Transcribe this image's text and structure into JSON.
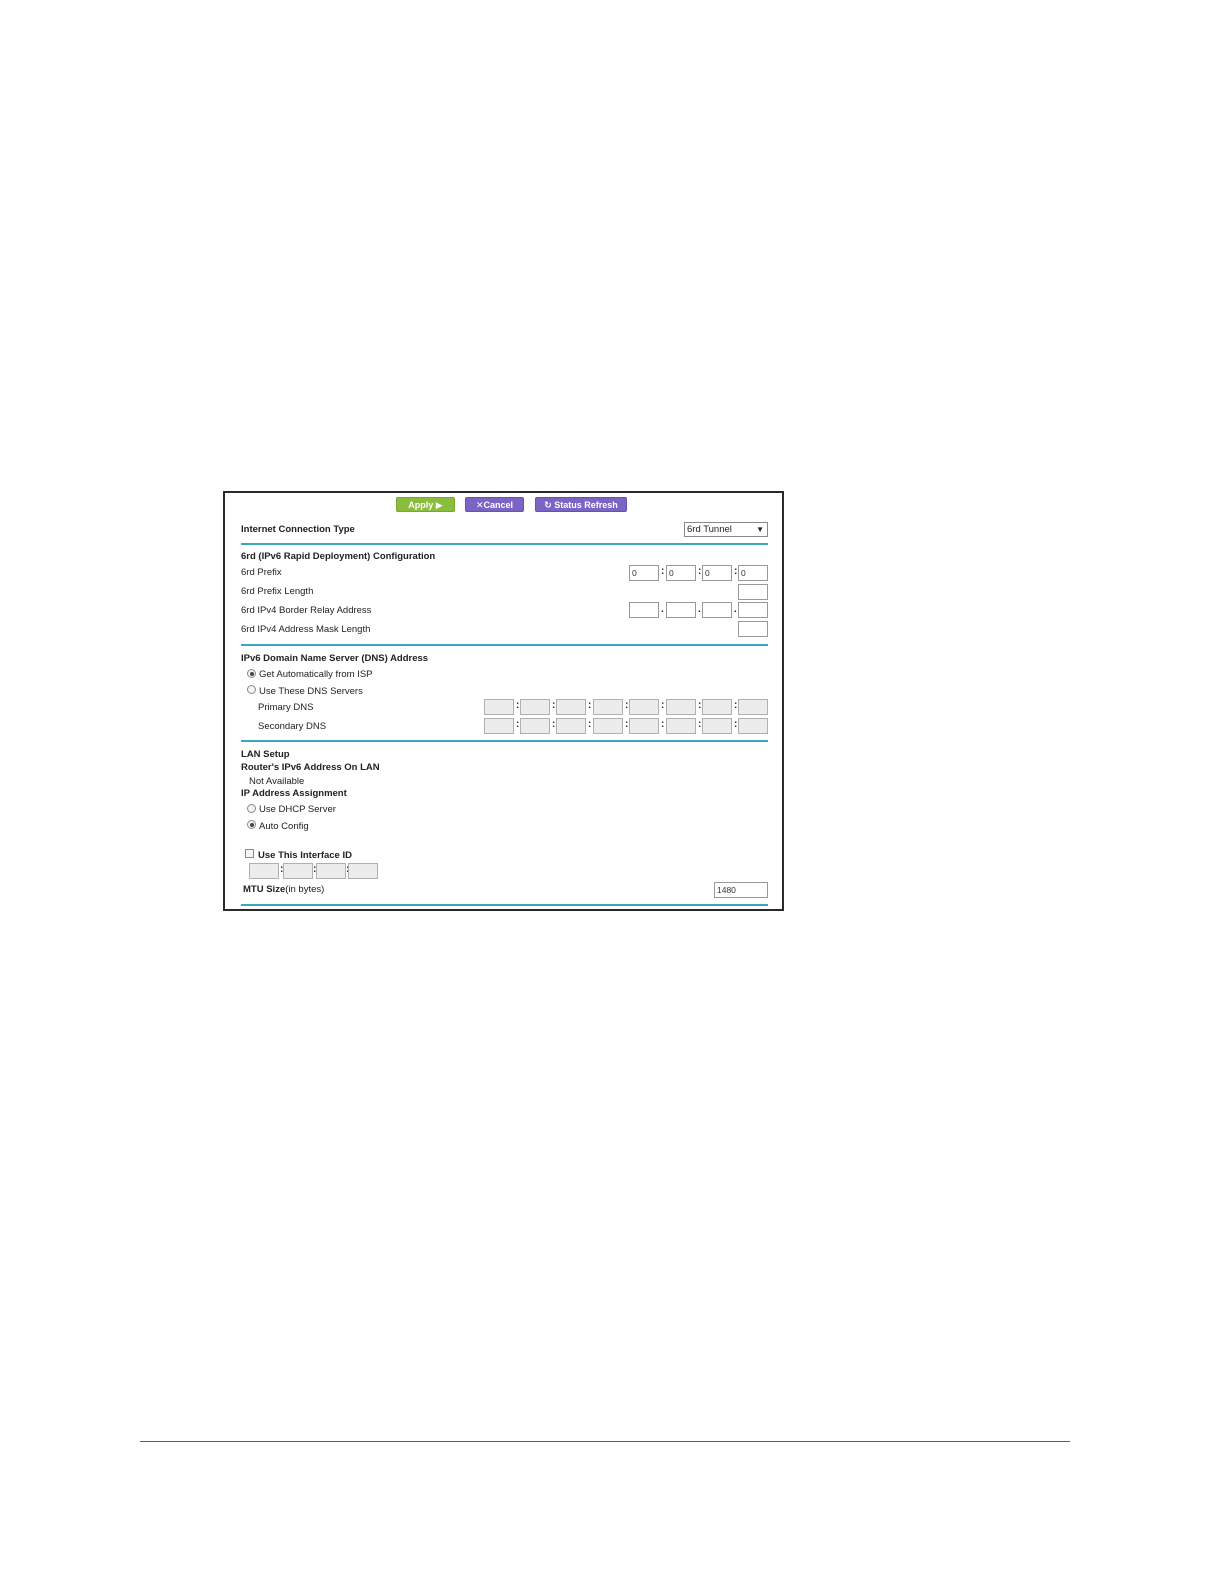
{
  "toolbar": {
    "apply_label": "Apply ▶",
    "cancel_label": "✕Cancel",
    "refresh_label": "↻ Status Refresh"
  },
  "connection_type": {
    "label": "Internet Connection Type",
    "selected": "6rd Tunnel"
  },
  "config_6rd": {
    "heading": "6rd (IPv6 Rapid Deployment) Configuration",
    "prefix_label": "6rd Prefix",
    "prefix_values": [
      "0",
      "0",
      "0",
      "0"
    ],
    "prefix_length_label": "6rd Prefix Length",
    "border_relay_label": "6rd IPv4 Border Relay Address",
    "mask_length_label": "6rd IPv4 Address Mask Length"
  },
  "dns": {
    "heading": "IPv6 Domain Name Server (DNS) Address",
    "option_auto": "Get Automatically from ISP",
    "option_manual": "Use These DNS Servers",
    "primary_label": "Primary DNS",
    "secondary_label": "Secondary DNS"
  },
  "lan": {
    "heading": "LAN Setup",
    "router_address_label": "Router's IPv6 Address On LAN",
    "router_address_value": "Not Available",
    "assignment_label": "IP Address Assignment",
    "option_dhcp": "Use DHCP Server",
    "option_auto": "Auto Config",
    "interface_id_label": "Use This Interface ID",
    "mtu_label": "MTU Size",
    "mtu_unit": "(in bytes)",
    "mtu_value": "1480"
  },
  "colors": {
    "accent_rule": "#3aa6c2",
    "apply_green": "#8bbd3c",
    "button_purple": "#7b64c4",
    "footer_rule": "#6e4b98"
  }
}
